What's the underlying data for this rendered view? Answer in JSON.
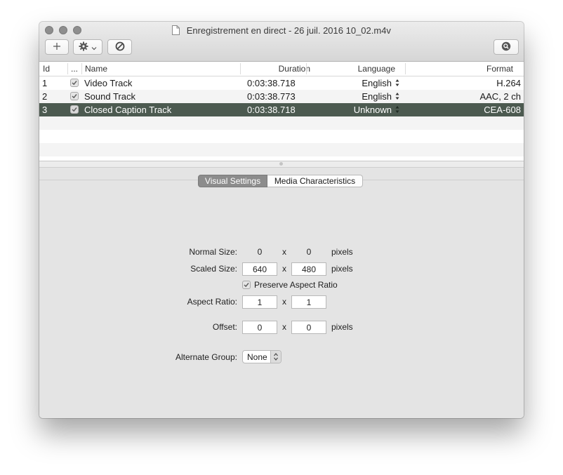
{
  "window": {
    "title": "Enregistrement en direct - 26 juil. 2016 10_02.m4v"
  },
  "toolbar": {
    "add_label": "+",
    "icons": [
      "plus-icon",
      "gear-icon",
      "chevron-down-icon",
      "prohibit-icon",
      "search-icon"
    ]
  },
  "table": {
    "headers": {
      "id": "Id",
      "enabled": "...",
      "name": "Name",
      "duration": "Duration",
      "language": "Language",
      "format": "Format"
    },
    "rows": [
      {
        "id": "1",
        "enabled": true,
        "name": "Video Track",
        "duration": "0:03:38.718",
        "language": "English",
        "format": "H.264",
        "selected": false
      },
      {
        "id": "2",
        "enabled": true,
        "name": "Sound Track",
        "duration": "0:03:38.773",
        "language": "English",
        "format": "AAC, 2 ch",
        "selected": false
      },
      {
        "id": "3",
        "enabled": true,
        "name": "Closed Caption Track",
        "duration": "0:03:38.718",
        "language": "Unknown",
        "format": "CEA-608",
        "selected": true
      }
    ]
  },
  "tabs": {
    "visual_settings": "Visual Settings",
    "media_characteristics": "Media Characteristics",
    "active": "Visual Settings"
  },
  "visual": {
    "normal_size_label": "Normal Size:",
    "normal_width": "0",
    "normal_height": "0",
    "scaled_size_label": "Scaled Size:",
    "scaled_width": "640",
    "scaled_height": "480",
    "preserve_aspect_label": "Preserve Aspect Ratio",
    "preserve_aspect_checked": true,
    "aspect_ratio_label": "Aspect Ratio:",
    "aspect_w": "1",
    "aspect_h": "1",
    "offset_label": "Offset:",
    "offset_x": "0",
    "offset_y": "0",
    "alternate_group_label": "Alternate Group:",
    "alternate_group_value": "None",
    "times": "x",
    "pixels": "pixels"
  },
  "colors": {
    "selection": "#4c5a50",
    "segment_active": "#8c8c8c"
  }
}
